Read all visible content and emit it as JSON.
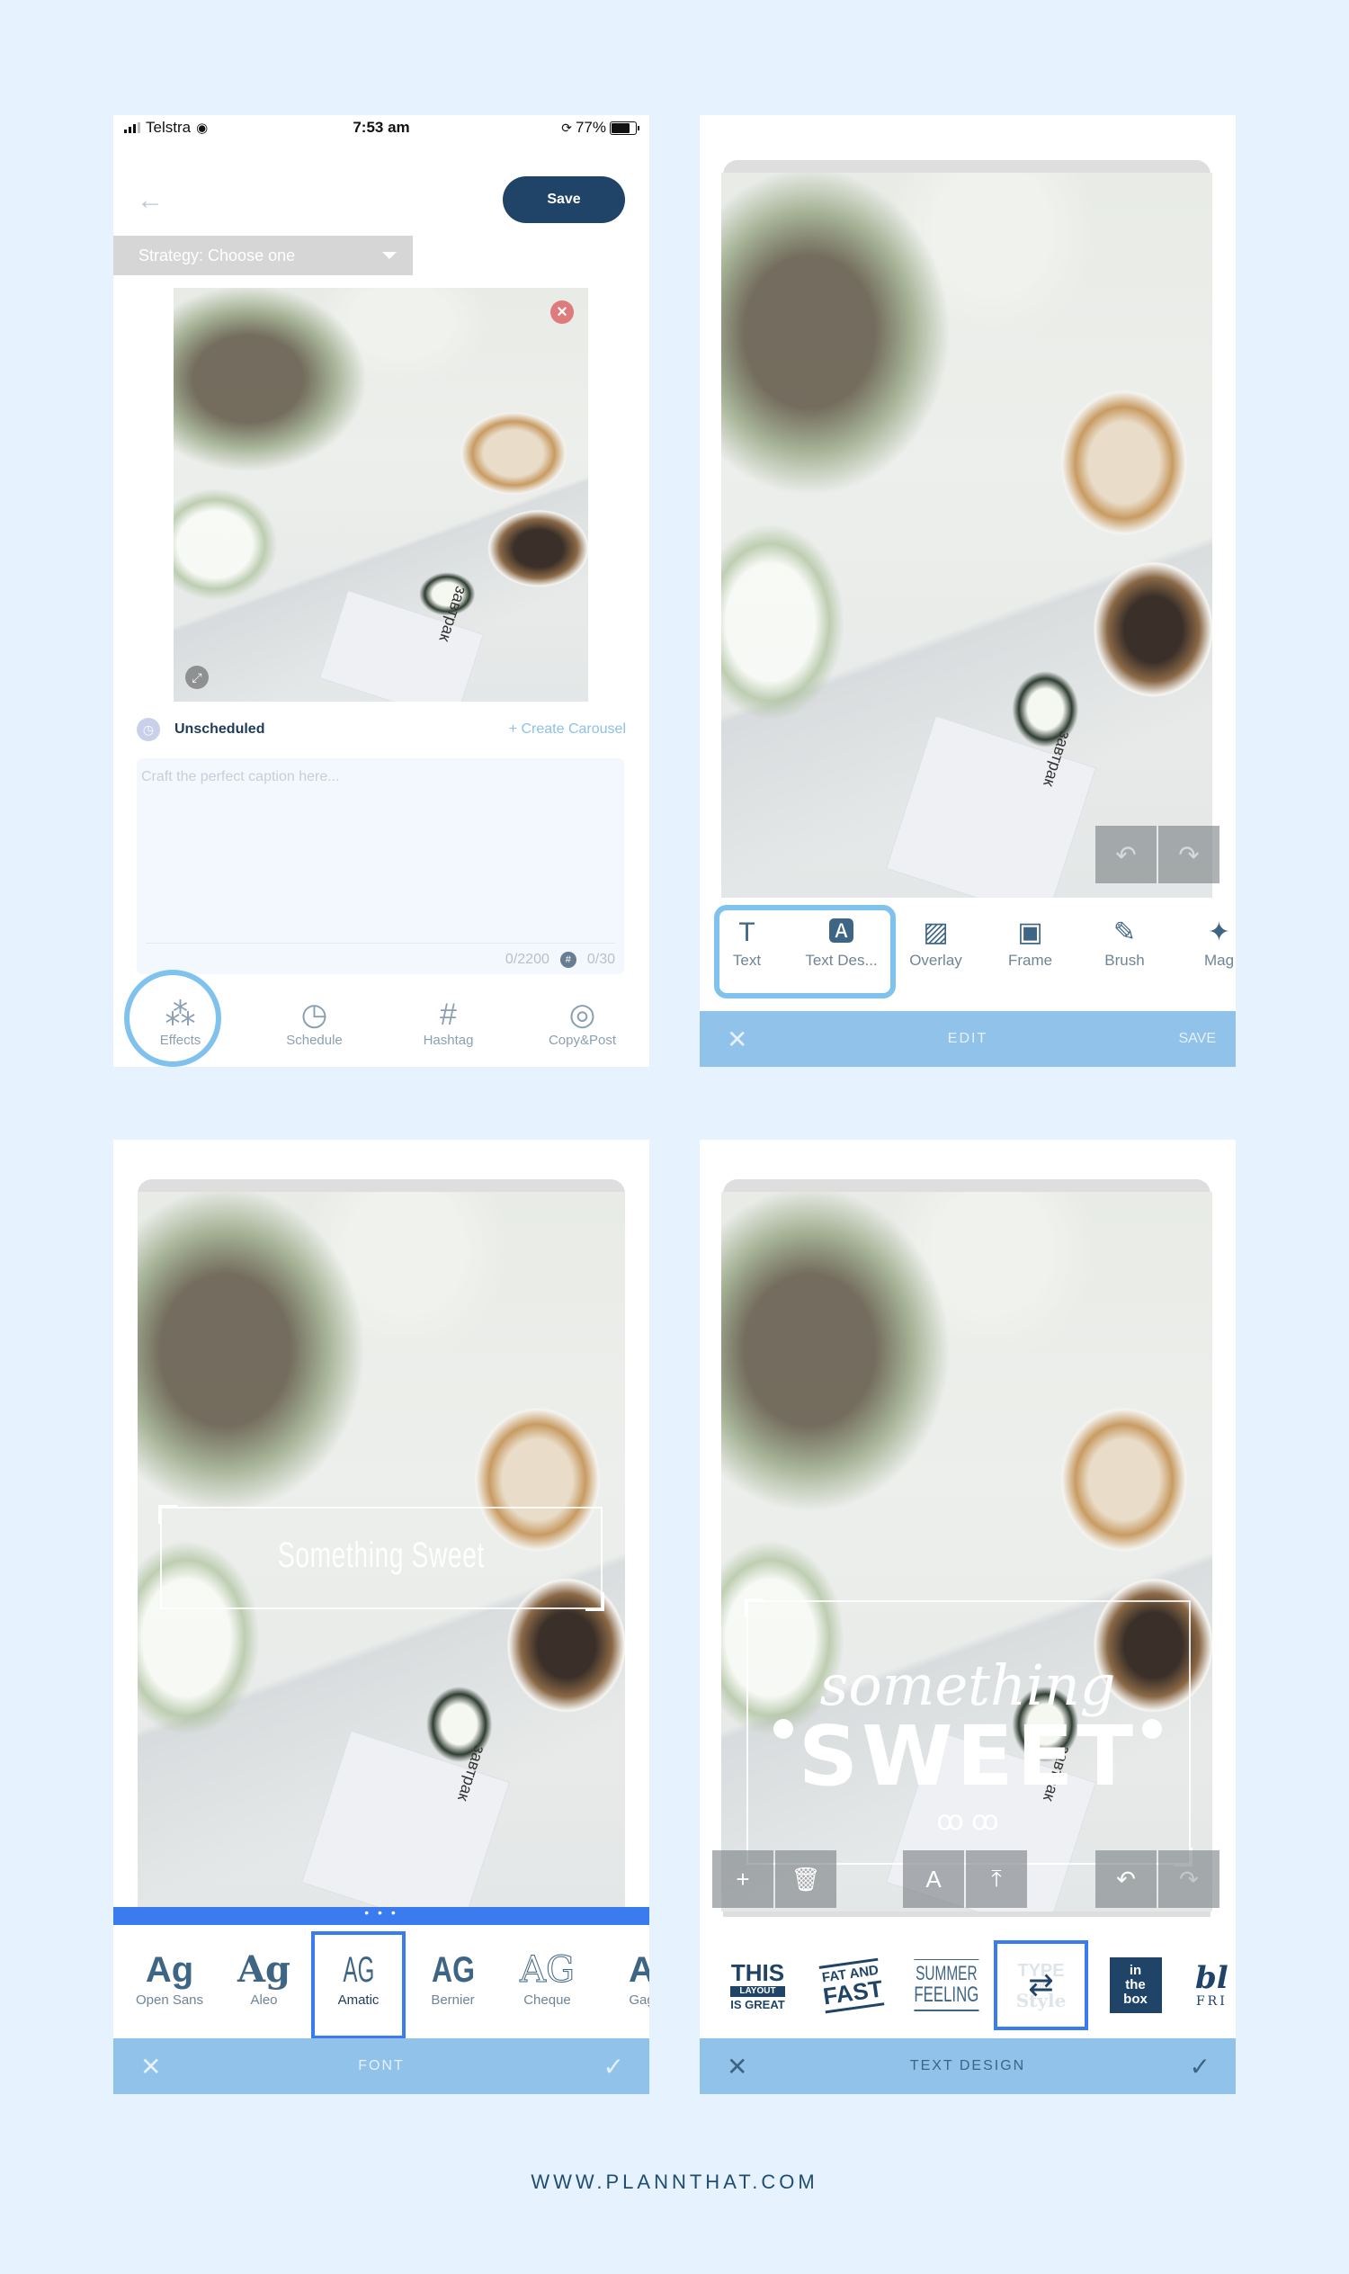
{
  "colors": {
    "background": "#E6F2FD",
    "primary_dark": "#1F4467",
    "accent_light": "#7FC2EE",
    "bar_blue": "#90C2EA",
    "select_blue": "#3A7BF0",
    "icon_blue": "#3F6585",
    "close_red": "#E07B7D"
  },
  "panel1": {
    "status_bar": {
      "carrier": "Telstra",
      "time": "7:53 am",
      "battery": "77%"
    },
    "header": {
      "back_icon": "arrow-left-icon",
      "save_label": "Save"
    },
    "strategy_select": {
      "value": "Strategy: Choose one"
    },
    "image": {
      "close_icon": "close-icon",
      "expand_icon": "expand-icon",
      "card_text": "завтрак"
    },
    "schedule": {
      "status": "Unscheduled",
      "carousel_link": "+ Create Carousel"
    },
    "caption": {
      "placeholder": "Craft the perfect caption here...",
      "char_count": "0/2200",
      "hashtag_count": "0/30"
    },
    "bottom_nav": [
      {
        "label": "Effects",
        "icon": "magic-wand-icon",
        "highlighted": true
      },
      {
        "label": "Schedule",
        "icon": "clock-icon"
      },
      {
        "label": "Hashtag",
        "icon": "hashtag-icon"
      },
      {
        "label": "Copy&Post",
        "icon": "instagram-icon"
      }
    ]
  },
  "panel2": {
    "tools": [
      {
        "label": "Text",
        "icon": "text-icon",
        "glyph": "T"
      },
      {
        "label": "Text Des...",
        "icon": "text-design-icon",
        "glyph": "🅰"
      },
      {
        "label": "Overlay",
        "icon": "overlay-icon",
        "glyph": "▨"
      },
      {
        "label": "Frame",
        "icon": "frame-icon",
        "glyph": "▣"
      },
      {
        "label": "Brush",
        "icon": "brush-icon",
        "glyph": "✎"
      },
      {
        "label": "Mag",
        "icon": "magic-icon",
        "glyph": "✦"
      }
    ],
    "bar": {
      "title": "EDIT",
      "save": "SAVE",
      "close": "✕"
    },
    "undo": "↶",
    "redo": "↷"
  },
  "panel3": {
    "overlay_text": "Something Sweet",
    "strip_dots": "• • •",
    "fonts": [
      {
        "label": "Open Sans",
        "sample": "Ag"
      },
      {
        "label": "Aleo",
        "sample": "Ag"
      },
      {
        "label": "Amatic",
        "sample": "AG",
        "selected": true
      },
      {
        "label": "Bernier",
        "sample": "AG"
      },
      {
        "label": "Cheque",
        "sample": "AG"
      },
      {
        "label": "Gag",
        "sample": "A"
      }
    ],
    "bar": {
      "title": "FONT",
      "close": "✕",
      "confirm": "✓"
    }
  },
  "panel4": {
    "overlay_text": {
      "script": "something",
      "bold": "SWEET",
      "flourish": "ꝏ ꝏ"
    },
    "tools": {
      "add": "+",
      "delete": "🗑",
      "font": "A",
      "upload": "⤒",
      "undo": "↶",
      "redo": "↷"
    },
    "designs": [
      {
        "name": "this-layout-is-great",
        "lines": [
          "THIS",
          "LAYOUT",
          "IS GREAT"
        ]
      },
      {
        "name": "fat-and-fast",
        "lines": [
          "FAT AND",
          "FAST"
        ]
      },
      {
        "name": "summer-feeling",
        "lines": [
          "SUMMER",
          "FEELING"
        ]
      },
      {
        "name": "type-with-style",
        "lines": [
          "TYPE",
          "with",
          "Style"
        ],
        "selected": true
      },
      {
        "name": "in-the-box",
        "lines": [
          "in",
          "the",
          "box"
        ]
      },
      {
        "name": "bl-fri",
        "lines": [
          "bl",
          "FRI"
        ]
      }
    ],
    "bar": {
      "title": "TEXT DESIGN",
      "close": "✕",
      "confirm": "✓"
    }
  },
  "footer": {
    "url": "WWW.PLANNTHAT.COM"
  }
}
